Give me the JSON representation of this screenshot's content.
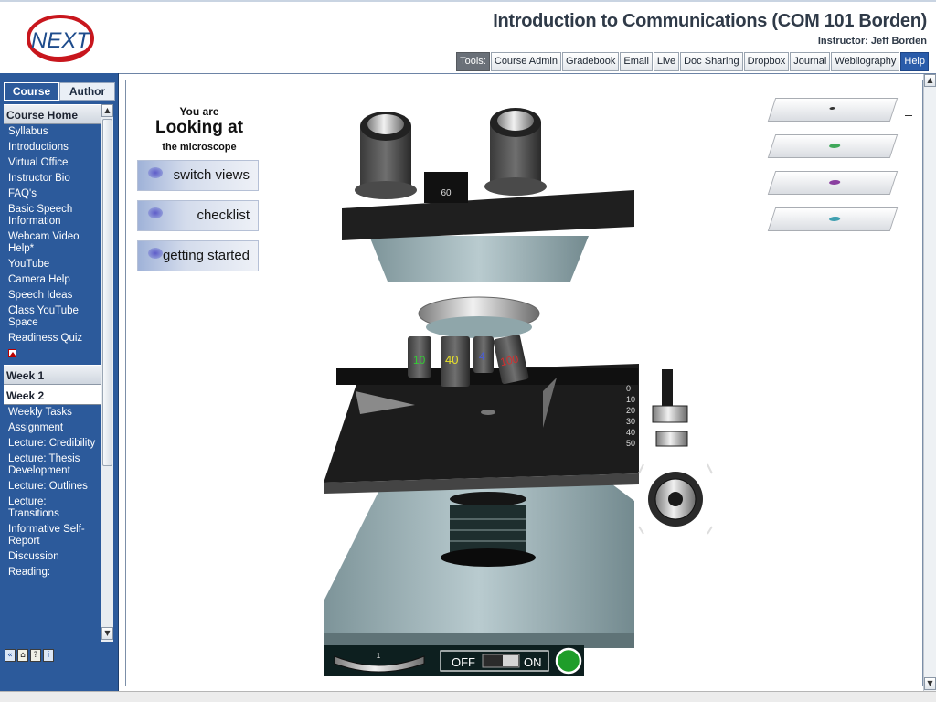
{
  "header": {
    "logo_text": "NEXT",
    "course_title": "Introduction to Communications (COM 101 Borden)",
    "instructor": "Instructor: Jeff Borden",
    "tools_label": "Tools:",
    "tools": [
      "Course Admin",
      "Gradebook",
      "Email",
      "Live",
      "Doc Sharing",
      "Dropbox",
      "Journal",
      "Webliography",
      "Help"
    ]
  },
  "nav": {
    "tabs": [
      "Course",
      "Author"
    ],
    "sections": [
      {
        "title": "Course Home",
        "items": [
          "Syllabus",
          "Introductions",
          "Virtual Office",
          "Instructor Bio",
          "FAQ's",
          "Basic Speech Information",
          "Webcam Video Help*",
          "YouTube",
          "Camera Help",
          "Speech Ideas",
          "Class YouTube Space",
          "Readiness Quiz"
        ]
      },
      {
        "title": "Week 1",
        "items": []
      },
      {
        "title": "Week 2",
        "items": [
          "Weekly Tasks",
          "Assignment",
          "Lecture: Credibility",
          "Lecture: Thesis Development",
          "Lecture: Outlines",
          "Lecture: Transitions",
          "Informative Self-Report",
          "Discussion",
          "Reading:"
        ]
      }
    ]
  },
  "microscope": {
    "you_are": "You are",
    "looking_at": "Looking at",
    "the_microscope": "the microscope",
    "buttons": [
      "switch views",
      "checklist",
      "getting started"
    ],
    "eyepiece_scale": "60",
    "objectives": [
      "10",
      "40",
      "4",
      "100"
    ],
    "stage_scale": [
      "0",
      "10",
      "20",
      "30",
      "40",
      "50"
    ],
    "dial_value": "1",
    "switch_off": "OFF",
    "switch_on": "ON",
    "slide_dot_colors": [
      "#333333",
      "#3fa85a",
      "#8a3fa0",
      "#3f9fb0"
    ]
  }
}
